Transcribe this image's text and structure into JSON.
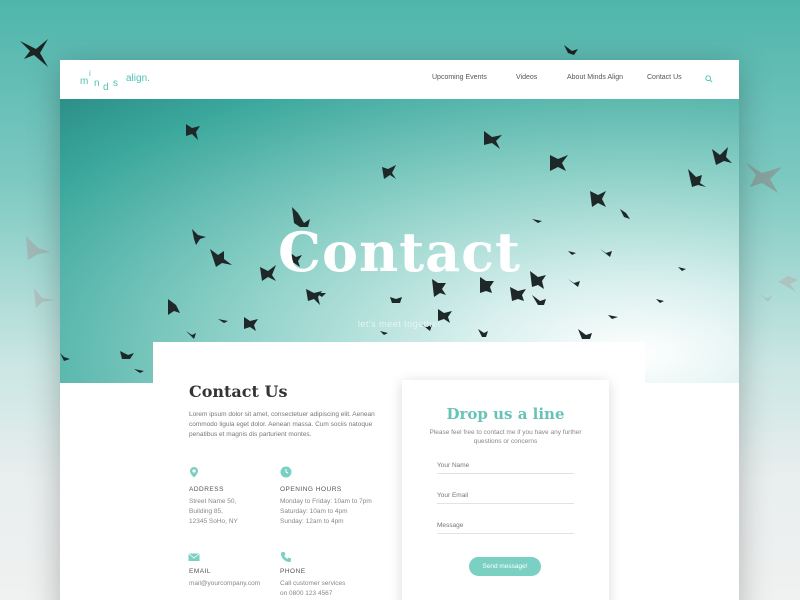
{
  "logo": {
    "m": "m",
    "i": "i",
    "n": "n",
    "d": "d",
    "s": "s",
    "suffix": "align."
  },
  "nav": {
    "items": [
      "Upcoming Events",
      "Videos",
      "About Minds Align",
      "Contact Us"
    ]
  },
  "hero": {
    "title": "Contact",
    "subtitle": "let's meet together"
  },
  "contact": {
    "title": "Contact Us",
    "intro": "Lorem ipsum dolor sit amet, consectetuer adipiscing elit. Aenean commodo ligula eget dolor. Aenean massa. Cum sociis natoque penatibus et magnis dis parturient montes.",
    "address": {
      "label": "ADDRESS",
      "value": "Street Name 50,\nBuilding 85,\n12345 SoHo, NY"
    },
    "hours": {
      "label": "OPENING HOURS",
      "value": "Monday to Friday: 10am to 7pm\nSaturday: 10am to 4pm\nSunday: 12am to 4pm"
    },
    "email": {
      "label": "EMAIL",
      "value": "mail@yourcompany.com"
    },
    "phone": {
      "label": "PHONE",
      "value": "Call customer services\non  0800 123 4567"
    }
  },
  "form": {
    "title": "Drop us a line",
    "description": "Please feel free to contact me if you have any further questions or concerns",
    "name_placeholder": "Your Name",
    "email_placeholder": "Your Email",
    "message_placeholder": "Message",
    "send_label": "Send message!"
  },
  "colors": {
    "accent": "#68c3b7",
    "button": "#7bd0c4",
    "hero_teal": "#3aa79c"
  },
  "icons": {
    "address": "map-pin-icon",
    "hours": "clock-icon",
    "email": "envelope-icon",
    "phone": "phone-icon",
    "search": "search-icon"
  }
}
